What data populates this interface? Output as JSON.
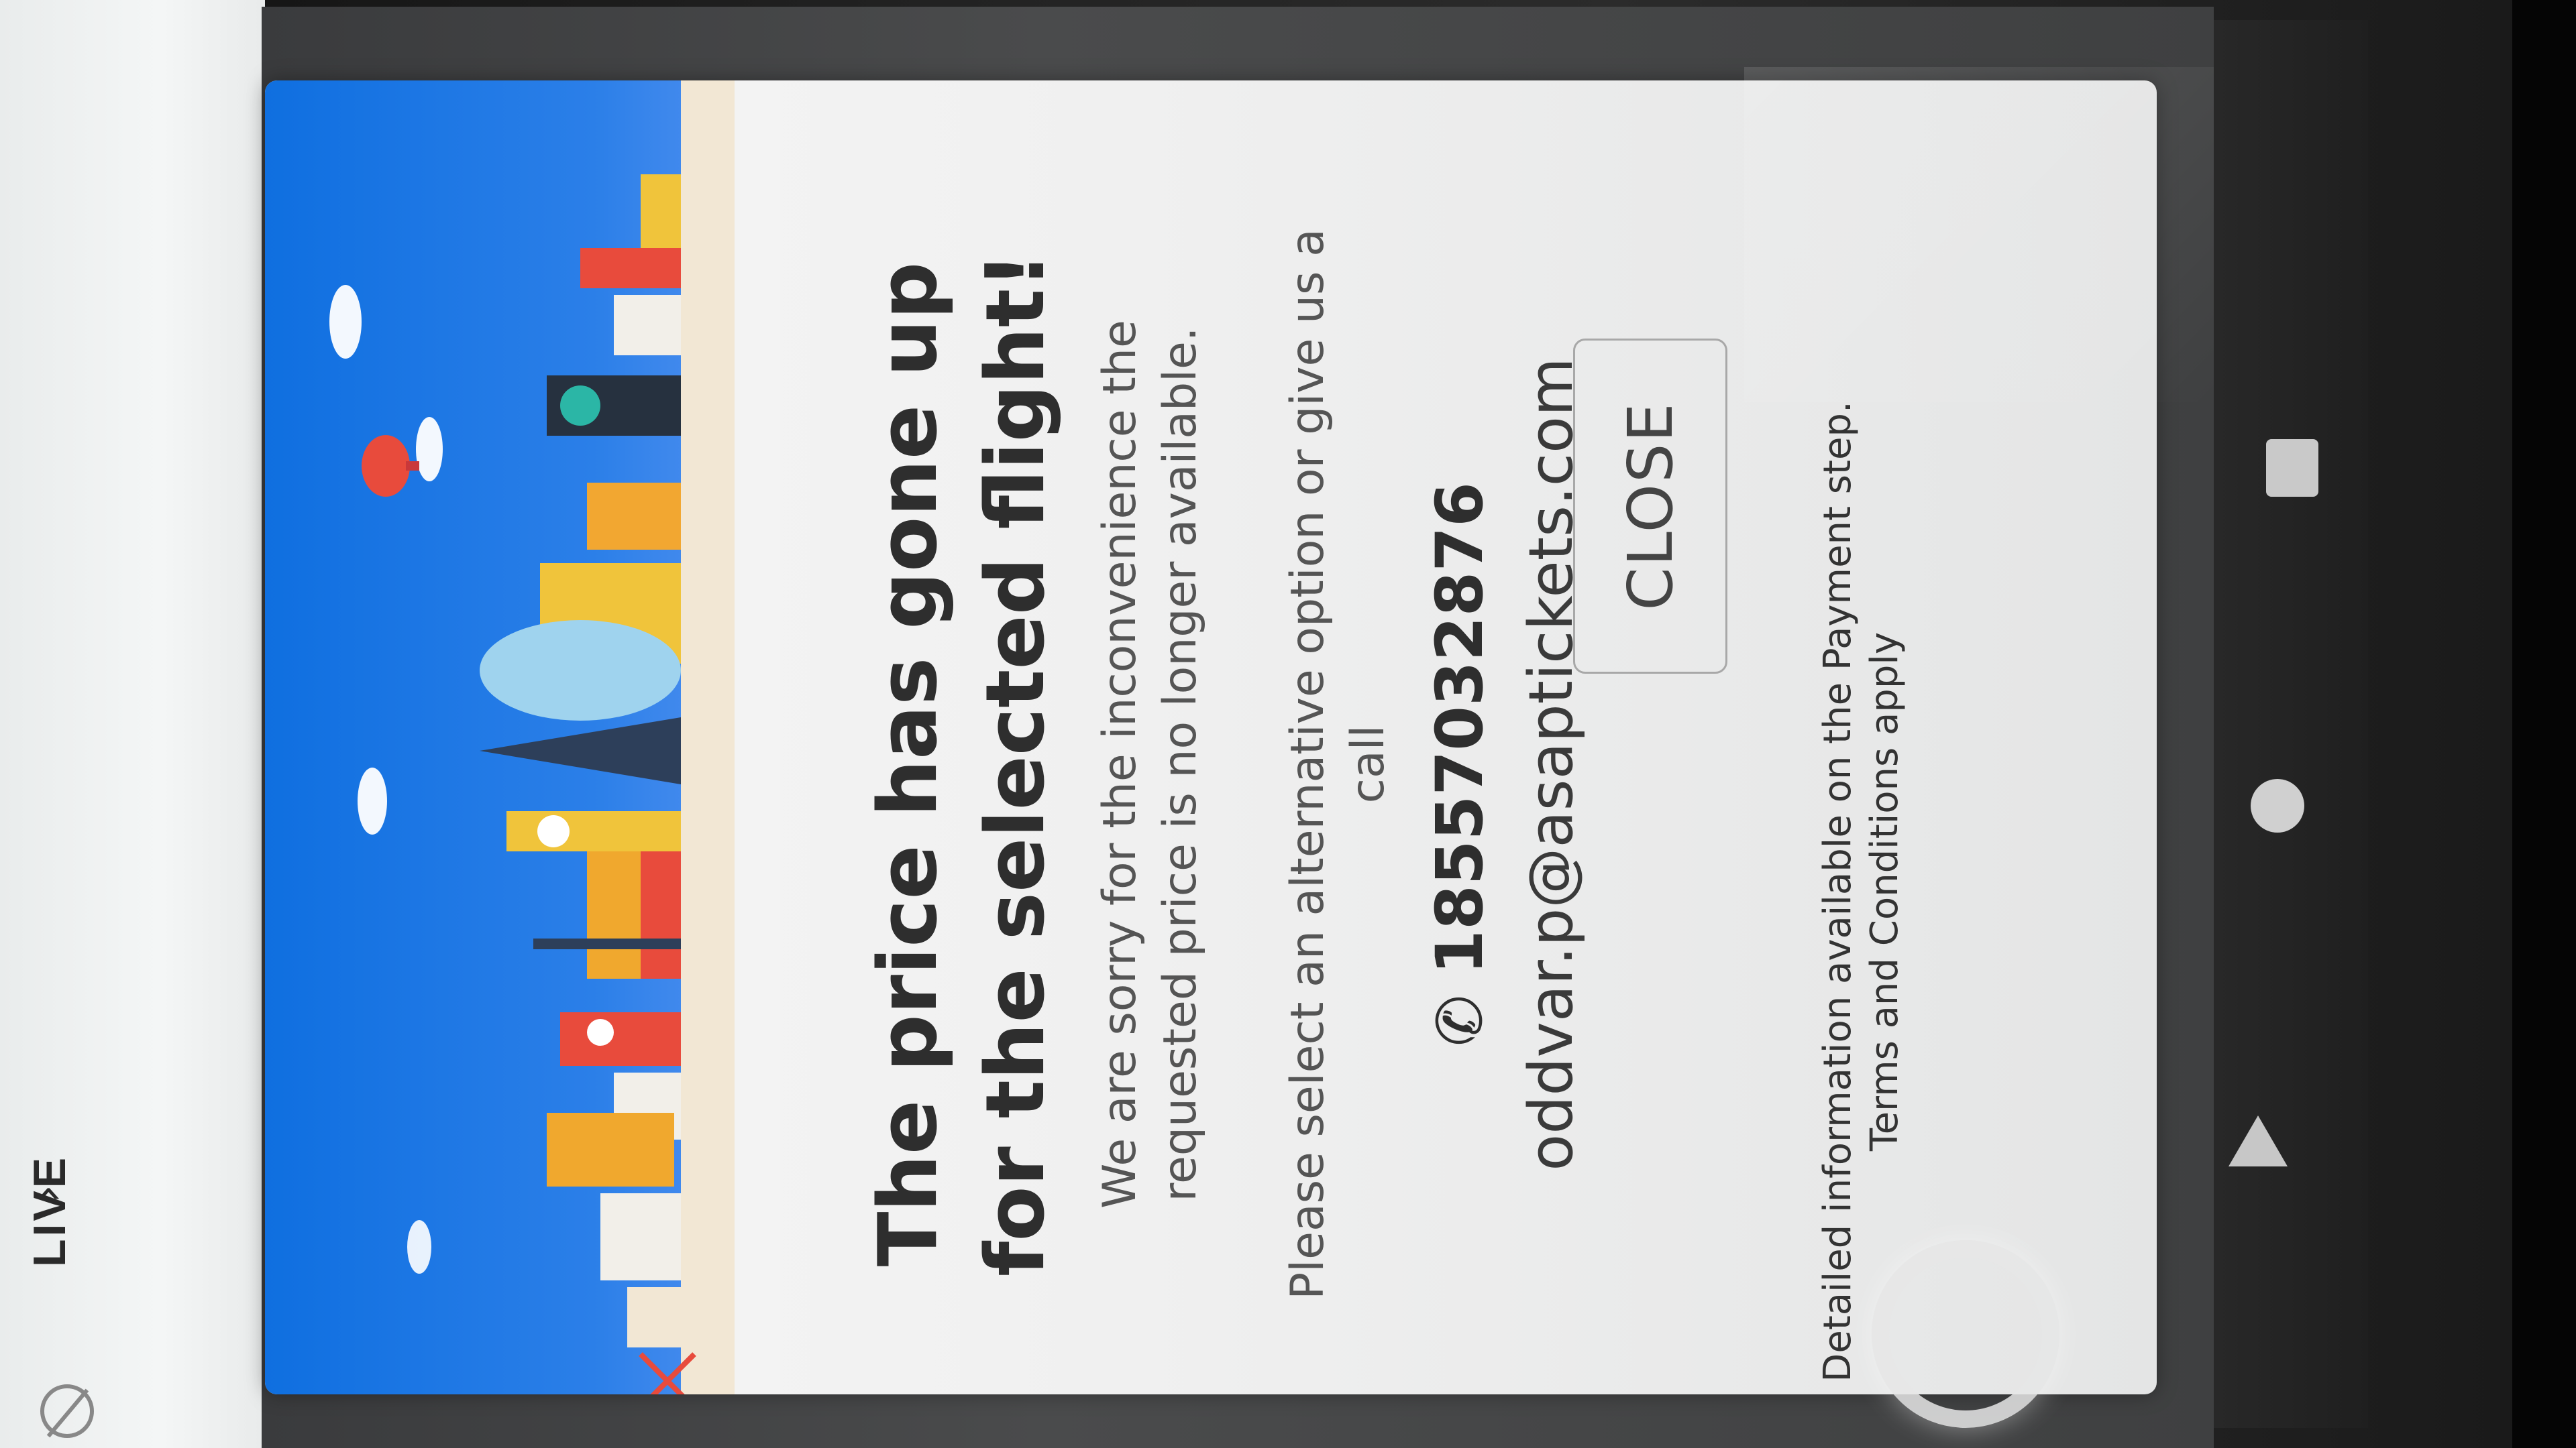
{
  "live_badge": {
    "label": "LIVE",
    "chevron_icon": "chevron-down-icon",
    "eye_icon": "eye-off-icon"
  },
  "dialog": {
    "title": "The price has gone up for the selected flight!",
    "message": "We are sorry for the inconvenience the requested price is no longer available.",
    "instruction": "Please select an alternative option or give us a call",
    "phone": "18557032876",
    "phone_icon": "phone-icon",
    "email": "oddvar.p@asaptickets.com",
    "close_label": "CLOSE",
    "footer": "Detailed information available on the Payment step. Terms and Conditions apply"
  },
  "android_nav": {
    "recents_icon": "square-icon",
    "home_icon": "circle-icon",
    "back_icon": "triangle-back-icon"
  },
  "colors": {
    "banner_sky": "#1f77e6",
    "dialog_bg": "#f2f2f2",
    "text_dark": "#2e2e2e",
    "text_muted": "#555555"
  }
}
